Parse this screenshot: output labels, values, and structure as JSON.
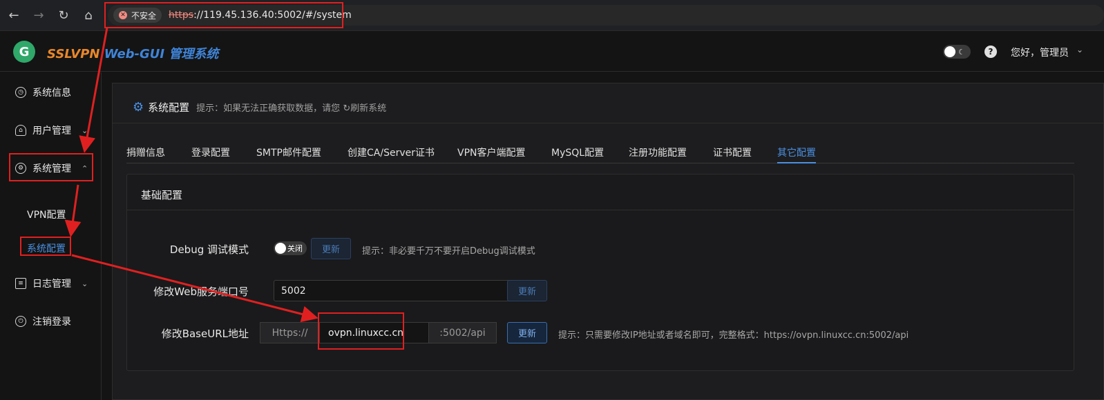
{
  "browser": {
    "nav": {
      "back": "←",
      "forward": "→",
      "reload": "↻",
      "home": "⌂"
    },
    "insecure_label": "不安全",
    "url_scheme": "https",
    "url_rest": "://119.45.136.40:5002/#/system"
  },
  "header": {
    "brand_part1": "SSLVPN",
    "brand_part2": " Web-GUI 管理系统",
    "logo_letter": "G",
    "help_icon": "?",
    "greeting": "您好，管理员"
  },
  "sidebar": {
    "items": [
      {
        "label": "系统信息",
        "icon": "clock-icon"
      },
      {
        "label": "用户管理",
        "icon": "user-icon"
      },
      {
        "label": "系统管理",
        "icon": "gear-icon"
      },
      {
        "label": "日志管理",
        "icon": "document-icon"
      },
      {
        "label": "注销登录",
        "icon": "power-icon"
      }
    ],
    "sub_items": [
      {
        "label": "VPN配置"
      },
      {
        "label": "系统配置"
      }
    ]
  },
  "page": {
    "title": "系统配置",
    "hint": "提示：如果无法正确获取数据，请您",
    "refresh_label": "刷新系统"
  },
  "tabs": [
    "捐赠信息",
    "登录配置",
    "SMTP邮件配置",
    "创建CA/Server证书",
    "VPN客户端配置",
    "MySQL配置",
    "注册功能配置",
    "证书配置",
    "其它配置"
  ],
  "active_tab": "其它配置",
  "card": {
    "title": "基础配置",
    "debug": {
      "label": "Debug 调试模式",
      "switch_text": "关闭",
      "button": "更新",
      "tip": "提示：非必要千万不要开启Debug调试模式"
    },
    "port": {
      "label": "修改Web服务端口号",
      "value": "5002",
      "button": "更新"
    },
    "baseurl": {
      "label": "修改BaseURL地址",
      "prefix": "Https://",
      "value": "ovpn.linuxcc.cn",
      "suffix": ":5002/api",
      "button": "更新",
      "tip": "提示：只需要修改IP地址或者域名即可，完整格式：https://ovpn.linuxcc.cn:5002/api"
    }
  },
  "colors": {
    "accent": "#4a90e2",
    "annotation": "#e02020",
    "brand_orange": "#e8872a"
  }
}
